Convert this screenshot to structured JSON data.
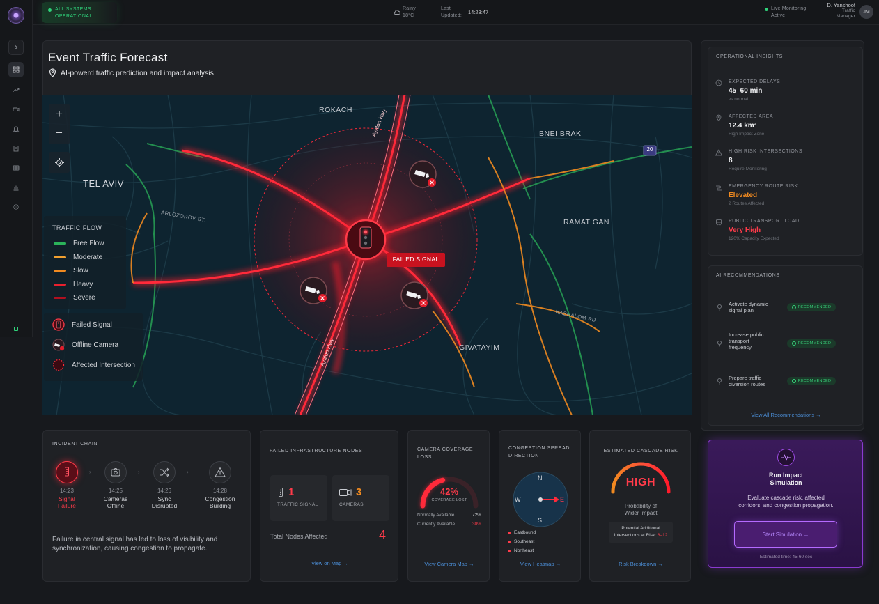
{
  "topbar": {
    "system_status": [
      "ALL SYSTEMS",
      "OPERATIONAL"
    ],
    "weather": [
      "Rainy",
      "18°C"
    ],
    "last_updated_label": [
      "Last",
      "Updated:"
    ],
    "last_updated_time": "14:23:47",
    "live_monitoring": [
      "Live Monitoring",
      "Active"
    ],
    "user_name": "D. Yanshoof",
    "user_role": [
      "Traffic",
      "Manager"
    ],
    "user_initials": "JM"
  },
  "header": {
    "title": "Event Traffic Forecast",
    "subtitle": "AI-powerd traffic prediction and impact analysis"
  },
  "map": {
    "places": [
      "ROKACH",
      "BNEI BRAK",
      "TEL AVIV",
      "RAMAT GAN",
      "GIVATAYIM"
    ],
    "streets": [
      "Ayalon Hwy",
      "ARLOZOROV ST.",
      "HASHALOM RD",
      "Ayalon Hwy"
    ],
    "route_badge": "20",
    "failed_signal_label": "FAILED SIGNAL",
    "legend": {
      "title": "TRAFFIC FLOW",
      "flow": [
        {
          "label": "Free Flow",
          "color": "#2bb35a"
        },
        {
          "label": "Moderate",
          "color": "#f0a030"
        },
        {
          "label": "Slow",
          "color": "#f08a20"
        },
        {
          "label": "Heavy",
          "color": "#e8202e"
        },
        {
          "label": "Severe",
          "color": "#b01020"
        }
      ],
      "markers": [
        "Failed Signal",
        "Offline Camera",
        "Affected Intersection"
      ]
    }
  },
  "insights": {
    "title": "OPERATIONAL INSIGHTS",
    "items": [
      {
        "label": "EXPECTED DELAYS",
        "value": "45–60 min",
        "sub": "vs normal",
        "color": "#f1f2f4",
        "icon": "clock-icon"
      },
      {
        "label": "AFFECTED AREA",
        "value": "12.4 km²",
        "sub": "High Impact Zone",
        "color": "#f1f2f4",
        "icon": "location-pin-icon"
      },
      {
        "label": "HIGH RISK INTERSECTIONS",
        "value": "8",
        "sub": "Require Monitoring",
        "color": "#f1f2f4",
        "icon": "warning-icon"
      },
      {
        "label": "EMERGENCY ROUTE RISK",
        "value": "Elevated",
        "sub": "2 Routes Affected",
        "color": "#f08a20",
        "icon": "route-icon"
      },
      {
        "label": "PUBLIC TRANSPORT LOAD",
        "value": "Very High",
        "sub": "120% Capacity Expected",
        "color": "#ff3b4a",
        "icon": "bus-icon"
      }
    ]
  },
  "recommendations": {
    "title": "AI RECOMMENDATIONS",
    "items": [
      {
        "text": [
          "Activate dynamic",
          "signal plan"
        ],
        "badge": "RECOMMENDED"
      },
      {
        "text": [
          "Increase public",
          "transport",
          "frequency"
        ],
        "badge": "RECOMMENDED"
      },
      {
        "text": [
          "Prepare traffic",
          "diversion routes"
        ],
        "badge": "RECOMMENDED"
      }
    ],
    "view_all": "View All Recommendations →"
  },
  "simulation": {
    "title": [
      "Run Impact",
      "Simulation"
    ],
    "description": [
      "Evaluate cascade risk, affected",
      "corridors, and congestion propagation."
    ],
    "button": "Start Simulation →",
    "estimate": "Estimated time: 45-60 sec"
  },
  "incident_chain": {
    "title": "INCIDENT CHAIN",
    "steps": [
      {
        "time": "14:23",
        "name": [
          "Signal",
          "Failure"
        ],
        "active": true
      },
      {
        "time": "14:25",
        "name": [
          "Cameras",
          "Offline"
        ],
        "active": false
      },
      {
        "time": "14:26",
        "name": [
          "Sync",
          "Disrupted"
        ],
        "active": false
      },
      {
        "time": "14:28",
        "name": [
          "Congestion",
          "Building"
        ],
        "active": false
      }
    ],
    "summary": [
      "Failure in central signal has led to loss of visibility and",
      "synchronization, causing congestion to propagate."
    ]
  },
  "failed_nodes": {
    "title": "FAILED INFRASTRUCTURE NODES",
    "traffic_signal_count": "1",
    "traffic_signal_label": "TRAFFIC SIGNAL",
    "cameras_count": "3",
    "cameras_label": "CAMERAS",
    "total_label": "Total Nodes Affected",
    "total_value": "4",
    "link": "View on Map →"
  },
  "camera_loss": {
    "title": [
      "CAMERA COVERAGE",
      "LOSS"
    ],
    "percent": "42%",
    "percent_value": 42,
    "gauge_label": "COVERAGE LOST",
    "rows": [
      {
        "label": "Normally Available",
        "value": "72%"
      },
      {
        "label": "Currently Available",
        "value": "30%"
      }
    ],
    "link": "View Camera Map →"
  },
  "congestion": {
    "title": [
      "CONGESTION SPREAD",
      "DIRECTION"
    ],
    "compass": [
      "N",
      "W",
      "E",
      "S"
    ],
    "directions": [
      "Eastbound",
      "Southeast",
      "Northeast"
    ],
    "link": "View Heatmap →"
  },
  "cascade": {
    "title": "ESTIMATED CASCADE RISK",
    "level": "HIGH",
    "caption": [
      "Probability of",
      "Wider Impact"
    ],
    "intersections_label": [
      "Potential Additional",
      "Intersections at Risk:"
    ],
    "intersections_value": "8–12",
    "link": "Risk Breakdown →"
  }
}
